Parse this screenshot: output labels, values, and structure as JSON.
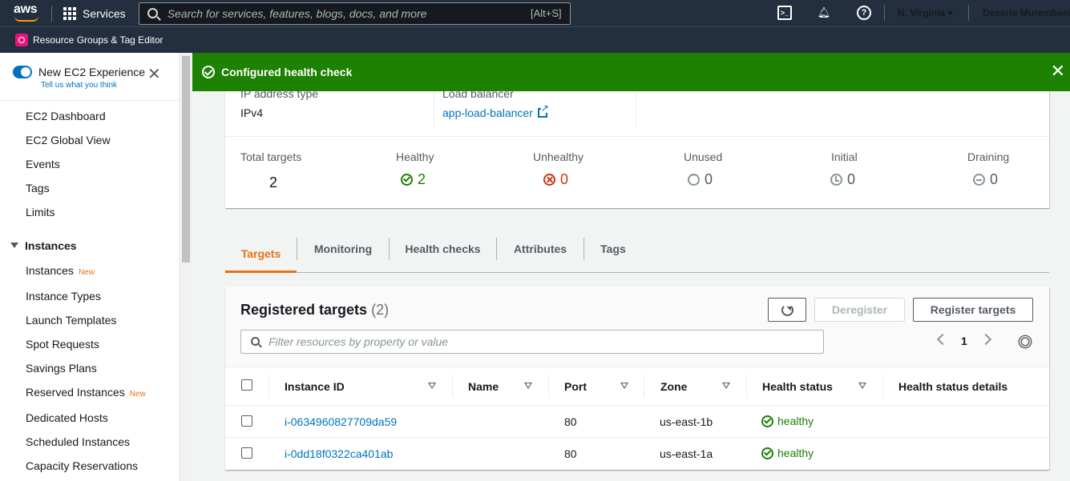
{
  "topnav": {
    "logo": "aws",
    "services": "Services",
    "search_placeholder": "Search for services, features, blogs, docs, and more",
    "search_shortcut": "[Alt+S]",
    "region": "N. Virginia ▾",
    "user": "Deserie Murembeni"
  },
  "subnav": {
    "resource_groups": "Resource Groups & Tag Editor"
  },
  "sidebar": {
    "experience_title": "New EC2 Experience",
    "experience_sub": "Tell us what you think",
    "items": [
      {
        "label": "EC2 Dashboard"
      },
      {
        "label": "EC2 Global View"
      },
      {
        "label": "Events"
      },
      {
        "label": "Tags"
      },
      {
        "label": "Limits"
      }
    ],
    "instances_heading": "Instances",
    "instance_items": [
      {
        "label": "Instances",
        "badge": "New"
      },
      {
        "label": "Instance Types"
      },
      {
        "label": "Launch Templates"
      },
      {
        "label": "Spot Requests"
      },
      {
        "label": "Savings Plans"
      },
      {
        "label": "Reserved Instances",
        "badge": "New"
      },
      {
        "label": "Dedicated Hosts"
      },
      {
        "label": "Scheduled Instances"
      },
      {
        "label": "Capacity Reservations"
      }
    ]
  },
  "flash": {
    "message": "Configured health check",
    "color": "#1d8102"
  },
  "details": {
    "ip_label": "IP address type",
    "ip_value": "IPv4",
    "lb_label": "Load balancer",
    "lb_value": "app-load-balancer",
    "stats": [
      {
        "label": "Total targets",
        "value": "2"
      },
      {
        "label": "Healthy",
        "value": "2"
      },
      {
        "label": "Unhealthy",
        "value": "0"
      },
      {
        "label": "Unused",
        "value": "0"
      },
      {
        "label": "Initial",
        "value": "0"
      },
      {
        "label": "Draining",
        "value": "0"
      }
    ]
  },
  "tabs": [
    "Targets",
    "Monitoring",
    "Health checks",
    "Attributes",
    "Tags"
  ],
  "registered": {
    "title": "Registered targets",
    "count": "(2)",
    "deregister": "Deregister",
    "register": "Register targets",
    "filter_placeholder": "Filter resources by property or value",
    "page": "1",
    "columns": [
      "Instance ID",
      "Name",
      "Port",
      "Zone",
      "Health status",
      "Health status details"
    ],
    "rows": [
      {
        "id": "i-0634960827709da59",
        "name": "",
        "port": "80",
        "zone": "us-east-1b",
        "health": "healthy",
        "details": ""
      },
      {
        "id": "i-0dd18f0322ca401ab",
        "name": "",
        "port": "80",
        "zone": "us-east-1a",
        "health": "healthy",
        "details": ""
      }
    ]
  },
  "colors": {
    "accent": "#ec7211",
    "link": "#0073bb",
    "success": "#1d8102",
    "error": "#d13212"
  }
}
